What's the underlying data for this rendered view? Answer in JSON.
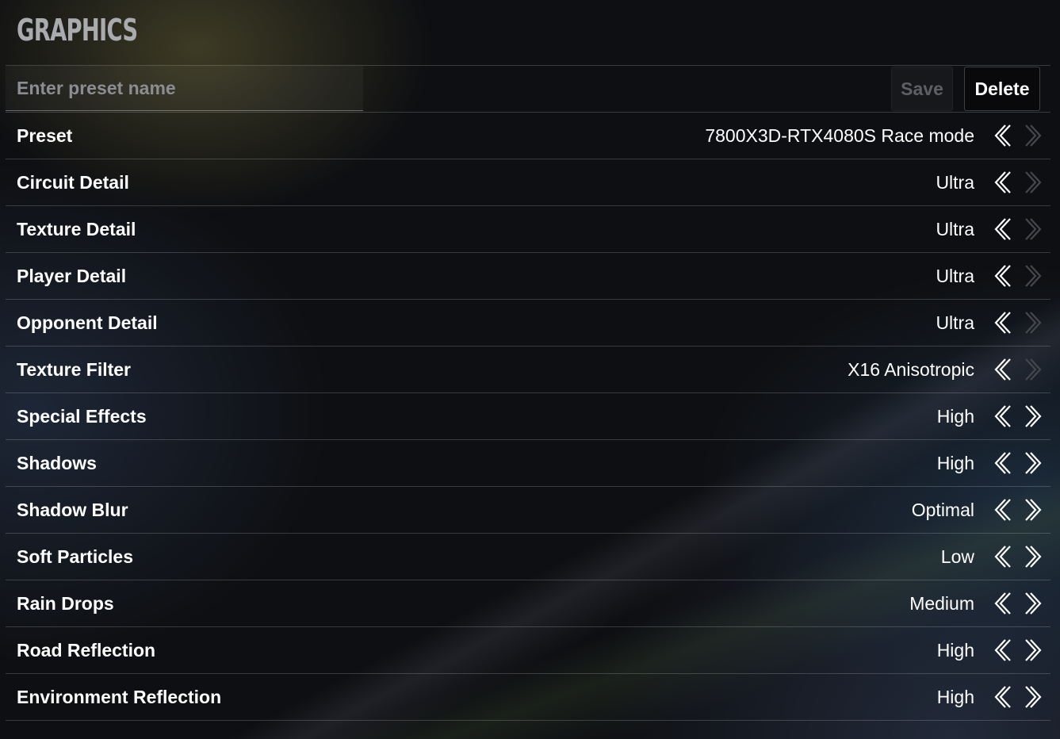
{
  "header": {
    "title": "GRAPHICS"
  },
  "preset_bar": {
    "input_placeholder": "Enter preset name",
    "input_value": "",
    "save_label": "Save",
    "delete_label": "Delete"
  },
  "colors": {
    "text": "#ffffff",
    "title": "#a9abaf",
    "placeholder": "#8b8d92",
    "disabled": "#5d5f64",
    "divider": "#3a3b3e"
  },
  "icons": {
    "left": "chevron-left-icon",
    "right": "chevron-right-icon"
  },
  "settings": [
    {
      "key": "preset",
      "label": "Preset",
      "value": "7800X3D-RTX4080S Race mode",
      "left_enabled": true,
      "right_enabled": false
    },
    {
      "key": "circuit-detail",
      "label": "Circuit Detail",
      "value": "Ultra",
      "left_enabled": true,
      "right_enabled": false
    },
    {
      "key": "texture-detail",
      "label": "Texture Detail",
      "value": "Ultra",
      "left_enabled": true,
      "right_enabled": false
    },
    {
      "key": "player-detail",
      "label": "Player Detail",
      "value": "Ultra",
      "left_enabled": true,
      "right_enabled": false
    },
    {
      "key": "opponent-detail",
      "label": "Opponent Detail",
      "value": "Ultra",
      "left_enabled": true,
      "right_enabled": false
    },
    {
      "key": "texture-filter",
      "label": "Texture Filter",
      "value": "X16 Anisotropic",
      "left_enabled": true,
      "right_enabled": false
    },
    {
      "key": "special-effects",
      "label": "Special Effects",
      "value": "High",
      "left_enabled": true,
      "right_enabled": true
    },
    {
      "key": "shadows",
      "label": "Shadows",
      "value": "High",
      "left_enabled": true,
      "right_enabled": true
    },
    {
      "key": "shadow-blur",
      "label": "Shadow Blur",
      "value": "Optimal",
      "left_enabled": true,
      "right_enabled": true
    },
    {
      "key": "soft-particles",
      "label": "Soft Particles",
      "value": "Low",
      "left_enabled": true,
      "right_enabled": true
    },
    {
      "key": "rain-drops",
      "label": "Rain Drops",
      "value": "Medium",
      "left_enabled": true,
      "right_enabled": true
    },
    {
      "key": "road-reflection",
      "label": "Road Reflection",
      "value": "High",
      "left_enabled": true,
      "right_enabled": true
    },
    {
      "key": "environment-reflection",
      "label": "Environment Reflection",
      "value": "High",
      "left_enabled": true,
      "right_enabled": true
    }
  ]
}
